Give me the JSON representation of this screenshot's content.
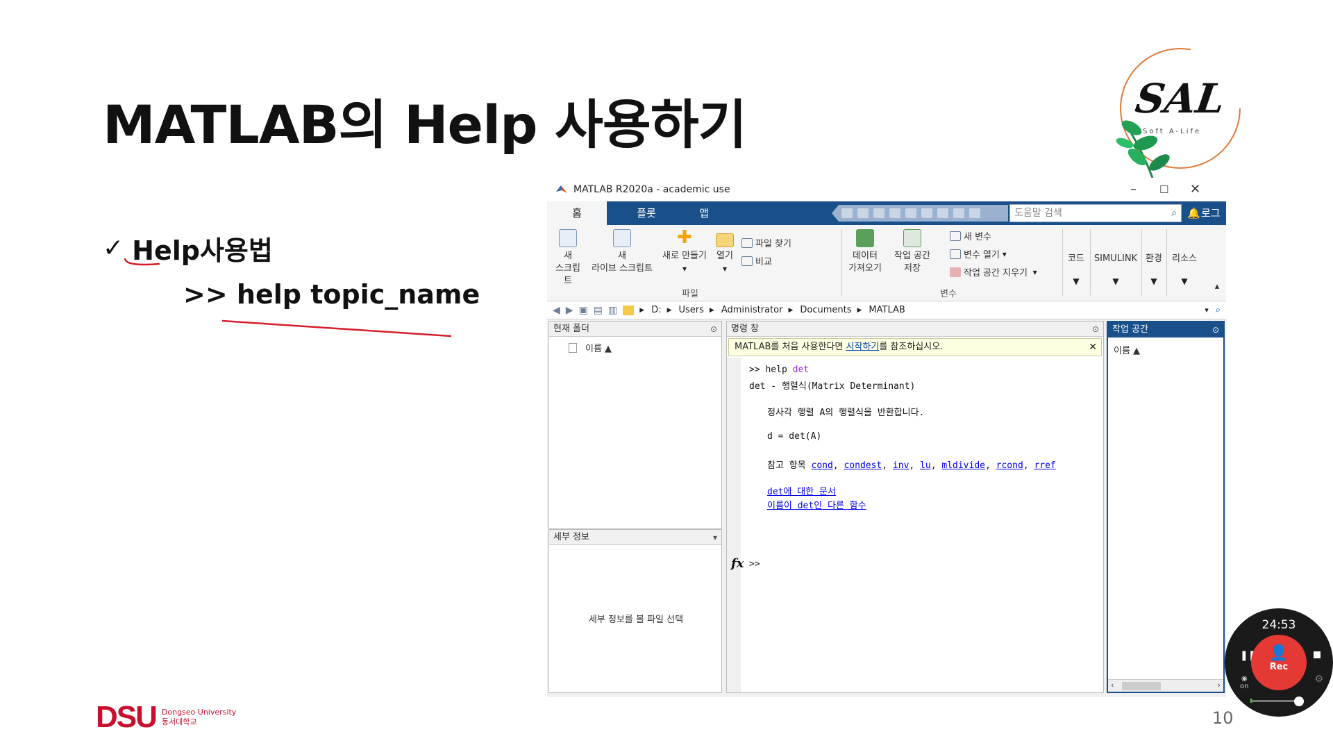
{
  "slide": {
    "title": "MATLAB의 Help 사용하기",
    "bullet_check": "✓",
    "bullet": "Help사용법",
    "code_line": ">> help topic_name",
    "page_number": "10"
  },
  "logo": {
    "text": "SAL",
    "subtitle": "Soft A-Life"
  },
  "university": {
    "abbr": "DSU",
    "name_en": "Dongseo University",
    "name_ko": "동서대학교"
  },
  "colors": {
    "ribbon_tab_bg": "#19508a",
    "brand_red": "#c8102e",
    "rec_red": "#e53935",
    "link": "#0000ee",
    "keyword": "#a020f0"
  },
  "matlab": {
    "window_title": "MATLAB R2020a - academic use",
    "window_controls": {
      "minimize": "–",
      "maximize": "☐",
      "close": "✕"
    },
    "tabs": [
      {
        "label": "홈"
      },
      {
        "label": "플롯"
      },
      {
        "label": "앱"
      }
    ],
    "help_search_placeholder": "도움말 검색",
    "login": "로그인",
    "ribbon": {
      "new_script": [
        "새",
        "스크립트"
      ],
      "new_live_script": [
        "새",
        "라이브 스크립트"
      ],
      "new": "새로 만들기",
      "open": "열기",
      "find_files": "파일 찾기",
      "compare": "비교",
      "file_group": "파일",
      "import_data": [
        "데이터",
        "가져오기"
      ],
      "save_workspace": [
        "작업 공간",
        "저장"
      ],
      "new_variable": "새 변수",
      "open_variable": "변수 열기",
      "clear_workspace": "작업 공간 지우기",
      "variable_group": "변수",
      "code": "코드",
      "simulink": "SIMULINK",
      "environment": "환경",
      "resources": "리소스"
    },
    "address": [
      "D:",
      "Users",
      "Administrator",
      "Documents",
      "MATLAB"
    ],
    "current_folder": {
      "title": "현재 폴더",
      "column": "이름 ▲"
    },
    "details": {
      "title": "세부 정보",
      "hint": "세부 정보를 볼 파일 선택"
    },
    "command_window": {
      "title": "명령 창",
      "notice_pre": "MATLAB를 처음 사용한다면 ",
      "notice_link": "시작하기",
      "notice_post": "를 참조하십시오.",
      "close": "✕",
      "cmd_prefix": ">> help ",
      "cmd_arg": "det",
      "line1": "det - 행렬식(Matrix Determinant)",
      "line2": "정사각 행렬 A의 행렬식을 반환합니다.",
      "line3": "d = det(A)",
      "see_also": "참고 항목",
      "see_also_links": [
        "cond",
        "condest",
        "inv",
        "lu",
        "mldivide",
        "rcond",
        "rref"
      ],
      "doc_link": "det에 대한 문서",
      "other_link": "이름이 det인 다른 함수",
      "fx": "fx",
      "prompt": ">>"
    },
    "workspace": {
      "title": "작업 공간",
      "column": "이름 ▲"
    }
  },
  "recorder": {
    "time": "24:53",
    "label": "Rec",
    "cam_label": "on"
  }
}
